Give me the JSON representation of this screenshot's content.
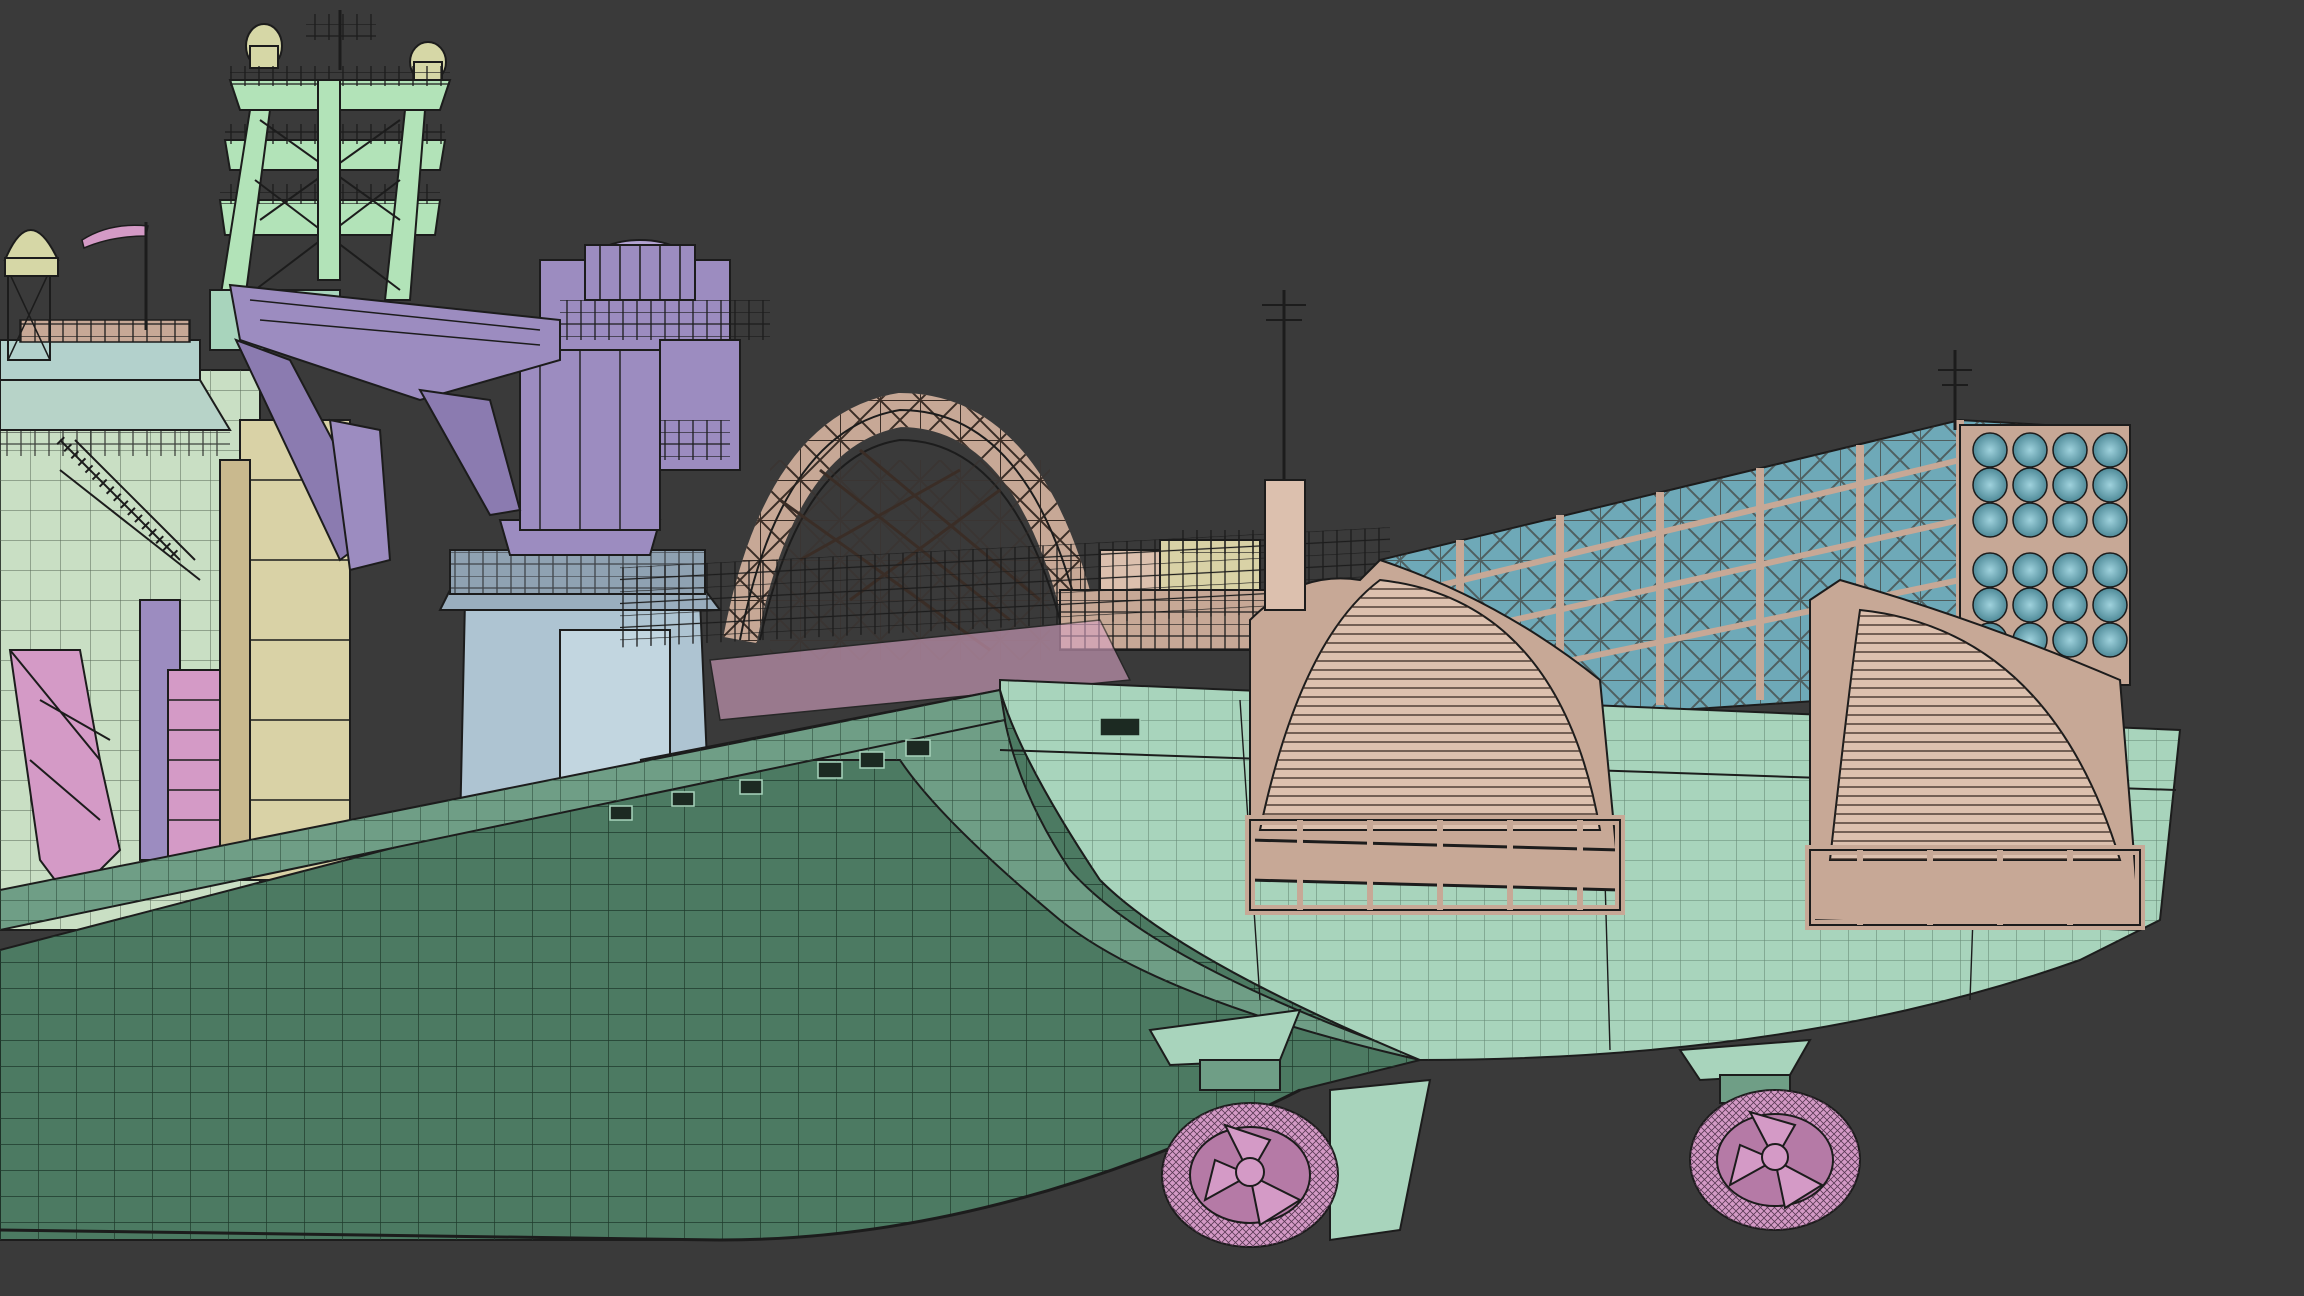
{
  "viewport": {
    "background": "#3a3a3a",
    "wireframe_color": "#1c1c1c"
  },
  "materials": {
    "hull": "#6f9e86",
    "hull_dark": "#4c7a62",
    "hull_light": "#a8d4bc",
    "superstructure": "#c9dfc4",
    "tower": "#d9d2a6",
    "crane": "#9c8cc0",
    "crane_dark": "#7b6ca0",
    "tan": "#c7a896",
    "tan_light": "#dcc0ae",
    "lifeboat_rack": "#6ea9b8",
    "propeller": "#d49ac6",
    "pedestal": "#aec4d2",
    "mast": "#b2e3b8",
    "radome": "#d6d7a6"
  },
  "model": {
    "name": "vessel-stern-wireframe",
    "azimuth_thrusters": 2,
    "stern_ramps": 2,
    "lifeboat_racks": 1,
    "cranes": 1
  }
}
